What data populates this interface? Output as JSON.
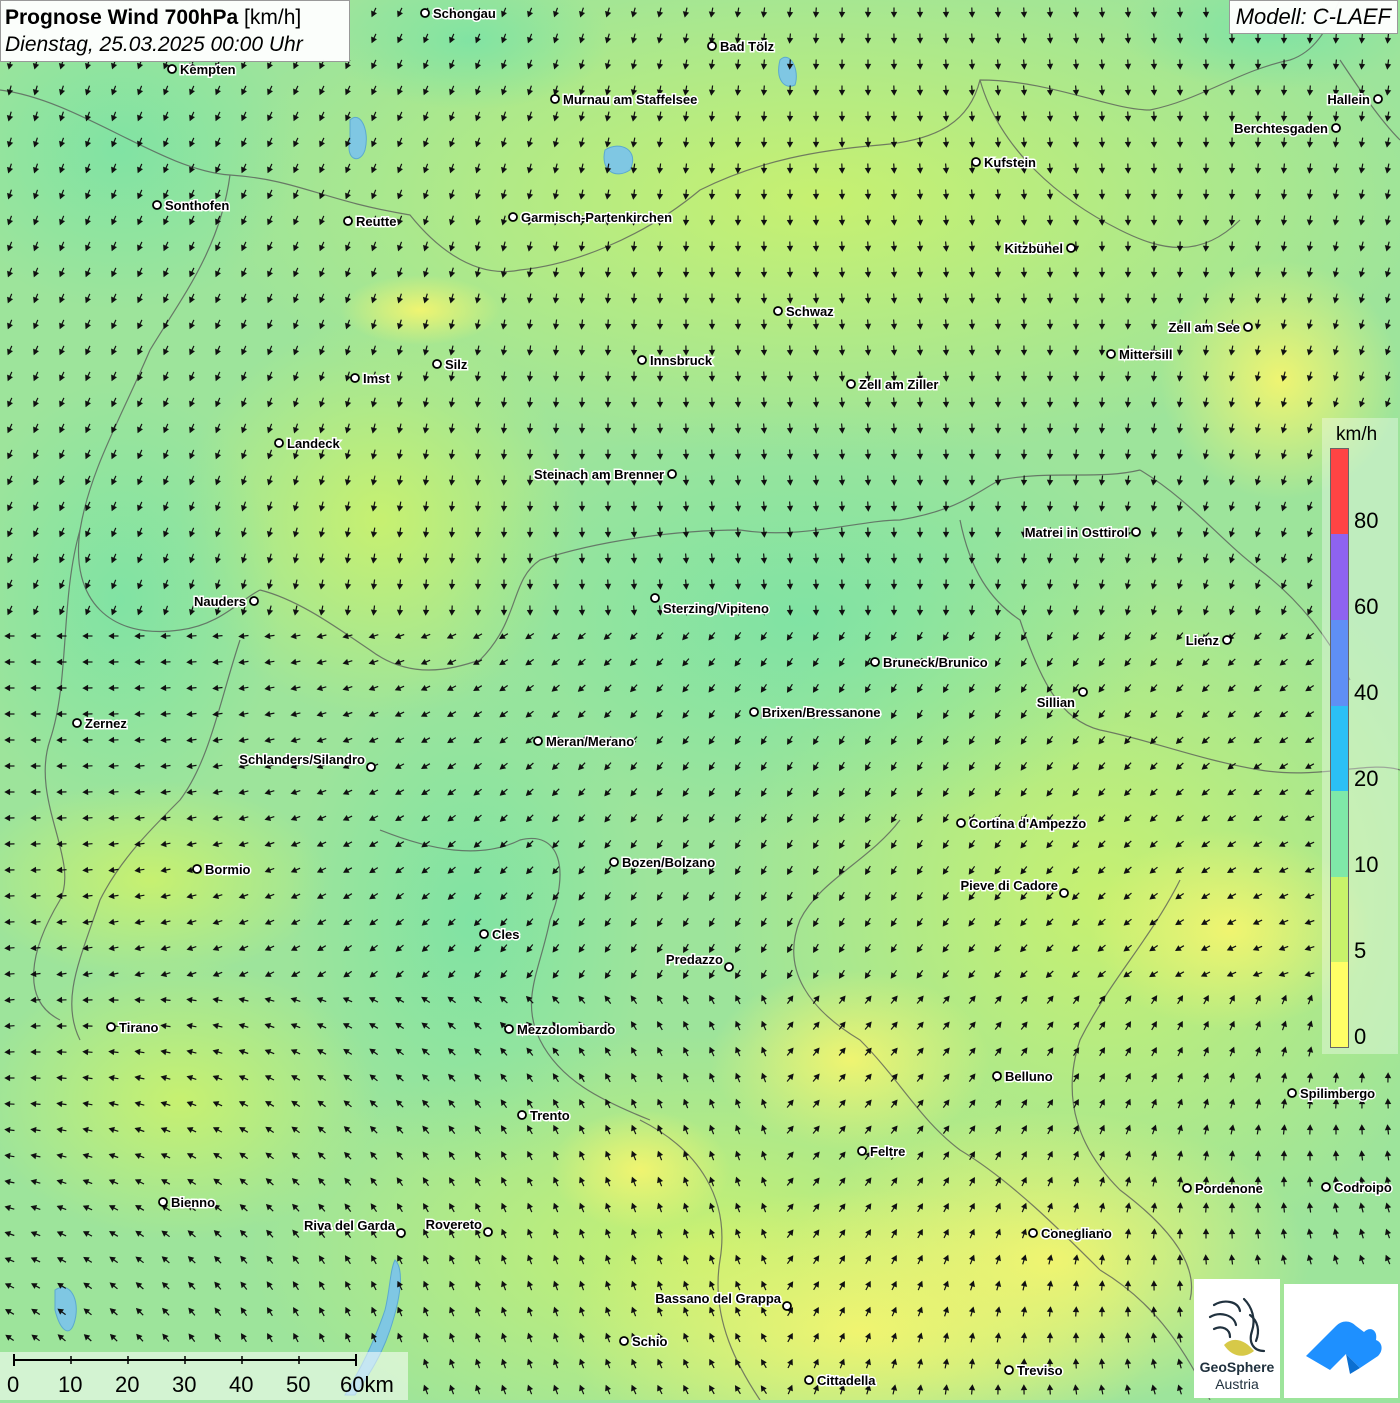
{
  "title": {
    "main": "Prognose Wind 700hPa",
    "unit": "[km/h]",
    "date": "Dienstag, 25.03.2025 00:00 Uhr"
  },
  "model": "Modell: C-LAEF",
  "legend": {
    "unit": "km/h",
    "ticks": [
      "80",
      "60",
      "40",
      "20",
      "10",
      "5",
      "0"
    ],
    "colors": [
      "#ff4444",
      "#8e63f0",
      "#5f8ff5",
      "#2bc0f5",
      "#7fe8a8",
      "#c8f36a",
      "#ffff66"
    ]
  },
  "scale": {
    "labels": [
      "0",
      "10",
      "20",
      "30",
      "40",
      "50",
      "60km"
    ]
  },
  "logo": {
    "line1": "GeoSphere",
    "line2": "Austria"
  },
  "cities": [
    {
      "name": "Schongau"
    },
    {
      "name": "Bad Tölz"
    },
    {
      "name": "Kempten"
    },
    {
      "name": "Murnau am Staffelsee"
    },
    {
      "name": "Hallein"
    },
    {
      "name": "Berchtesgaden"
    },
    {
      "name": "Kufstein"
    },
    {
      "name": "Sonthofen"
    },
    {
      "name": "Reutte"
    },
    {
      "name": "Garmisch-Partenkirchen"
    },
    {
      "name": "Kitzbühel"
    },
    {
      "name": "Schwaz"
    },
    {
      "name": "Zell am See"
    },
    {
      "name": "Mittersill"
    },
    {
      "name": "Silz"
    },
    {
      "name": "Innsbruck"
    },
    {
      "name": "Imst"
    },
    {
      "name": "Zell am Ziller"
    },
    {
      "name": "Landeck"
    },
    {
      "name": "Steinach am Brenner"
    },
    {
      "name": "Matrei in Osttirol"
    },
    {
      "name": "Nauders"
    },
    {
      "name": "Sterzing/Vipiteno"
    },
    {
      "name": "Lienz"
    },
    {
      "name": "Bruneck/Brunico"
    },
    {
      "name": "Sillian"
    },
    {
      "name": "Brixen/Bressanone"
    },
    {
      "name": "Zernez"
    },
    {
      "name": "Meran/Merano"
    },
    {
      "name": "Schlanders/Silandro"
    },
    {
      "name": "Cortina d'Ampezzo"
    },
    {
      "name": "Bozen/Bolzano"
    },
    {
      "name": "Bormio"
    },
    {
      "name": "Pieve di Cadore"
    },
    {
      "name": "Cles"
    },
    {
      "name": "Predazzo"
    },
    {
      "name": "Tirano"
    },
    {
      "name": "Mezzolombardo"
    },
    {
      "name": "Belluno"
    },
    {
      "name": "Spilimbergo"
    },
    {
      "name": "Trento"
    },
    {
      "name": "Feltre"
    },
    {
      "name": "Pordenone"
    },
    {
      "name": "Codroipo"
    },
    {
      "name": "Bienno"
    },
    {
      "name": "Riva del Garda"
    },
    {
      "name": "Rovereto"
    },
    {
      "name": "Conegliano"
    },
    {
      "name": "Bassano del Grappa"
    },
    {
      "name": "Schio"
    },
    {
      "name": "Treviso"
    },
    {
      "name": "Cittadella"
    }
  ]
}
